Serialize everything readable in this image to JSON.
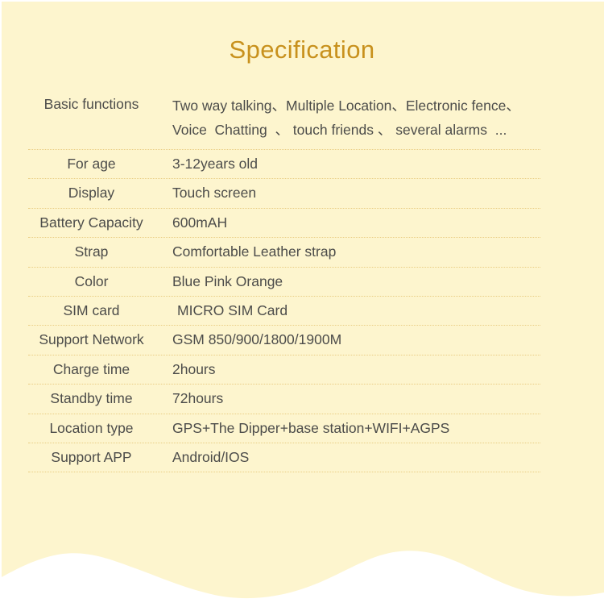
{
  "page": {
    "title": "Specification",
    "background_color": "#fdf5ce",
    "title_color": "#c8911d",
    "text_color": "#4c4c4a",
    "separator_color": "#e9cd84",
    "wave_color": "#ffffff"
  },
  "spec_rows": [
    {
      "label": "Basic functions",
      "value": "Two way talking、Multiple Location、Electronic fence、\nVoice  Chatting  、 touch friends 、 several alarms  ...",
      "multiline": true
    },
    {
      "label": "For age",
      "value": "3-12years old"
    },
    {
      "label": "Display",
      "value": "Touch screen"
    },
    {
      "label": "Battery Capacity",
      "value": "600mAH"
    },
    {
      "label": "Strap",
      "value": "Comfortable Leather strap"
    },
    {
      "label": "Color",
      "value": "Blue Pink Orange"
    },
    {
      "label": "SIM card",
      "value": "MICRO SIM Card",
      "indent": true
    },
    {
      "label": "Support Network",
      "value": "GSM 850/900/1800/1900M"
    },
    {
      "label": "Charge time",
      "value": "2hours"
    },
    {
      "label": "Standby time",
      "value": "72hours"
    },
    {
      "label": "Location type",
      "value": "GPS+The Dipper+base station+WIFI+AGPS"
    },
    {
      "label": "Support APP",
      "value": "Android/IOS"
    }
  ]
}
